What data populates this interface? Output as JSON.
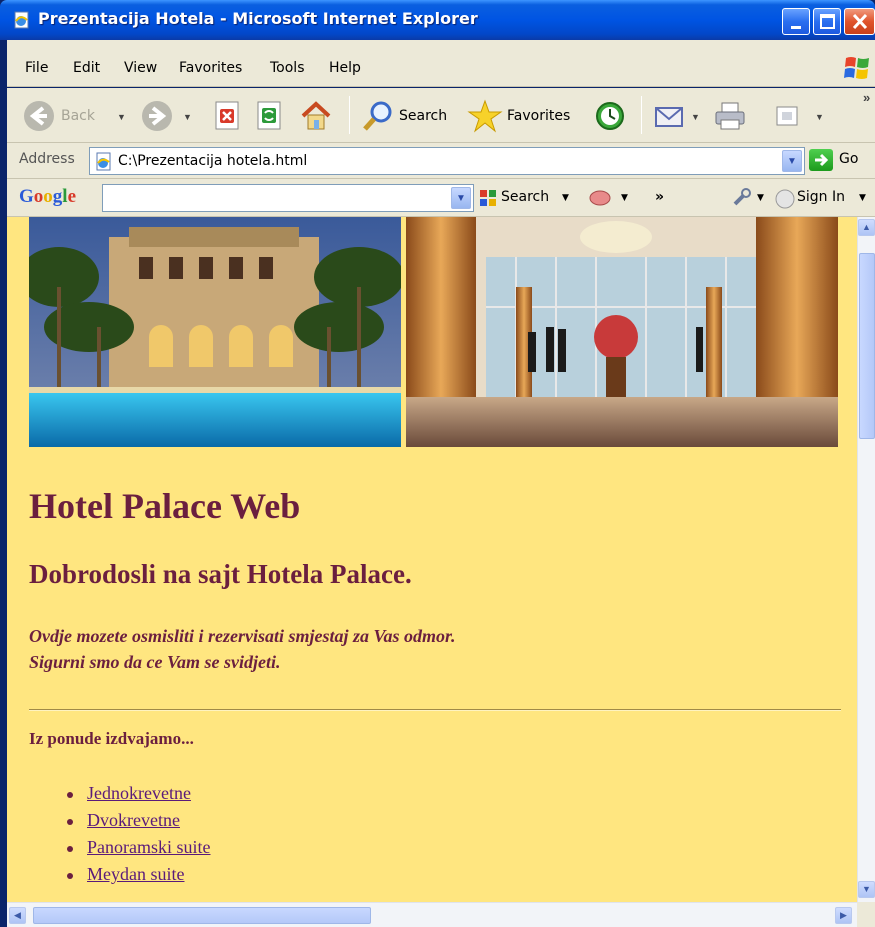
{
  "window": {
    "title": "Prezentacija Hotela - Microsoft Internet Explorer",
    "minimize_glyph": "_",
    "maximize_glyph": "□",
    "close_glyph": "X"
  },
  "menubar": {
    "items": [
      "File",
      "Edit",
      "View",
      "Favorites",
      "Tools",
      "Help"
    ]
  },
  "toolbar": {
    "back_label": "Back",
    "search_label": "Search",
    "favorites_label": "Favorites",
    "more_label": "»"
  },
  "addressbar": {
    "label": "Address",
    "url": "C:\\Prezentacija hotela.html",
    "go_label": "Go"
  },
  "googlebar": {
    "logo": "Google",
    "search_value": "",
    "search_label": "Search",
    "more_label": "»",
    "signin_label": "Sign In"
  },
  "page": {
    "title": "Hotel Palace Web",
    "subtitle": "Dobrodosli na sajt Hotela Palace.",
    "intro_line1": "Ovdje mozete osmisliti i rezervisati smjestaj za Vas odmor.",
    "intro_line2": "Sigurni smo da ce Vam se svidjeti.",
    "section_label": "Iz ponude izdvajamo...",
    "offers": [
      "Jednokrevetne",
      "Dvokrevetne",
      "Panoramski suite",
      "Meydan suite"
    ]
  },
  "colors": {
    "page_background": "#ffe680",
    "heading": "#6b1f3f",
    "link": "#5a1a7a",
    "titlebar": "#0054e3"
  },
  "icons": {
    "back": "back-arrow-icon",
    "forward": "forward-arrow-icon",
    "stop": "stop-icon",
    "refresh": "refresh-icon",
    "home": "home-icon",
    "search": "search-magnifier-icon",
    "favorites": "favorites-star-icon",
    "history": "history-icon",
    "mail": "mail-icon",
    "print": "print-icon",
    "edit": "edit-page-icon"
  }
}
